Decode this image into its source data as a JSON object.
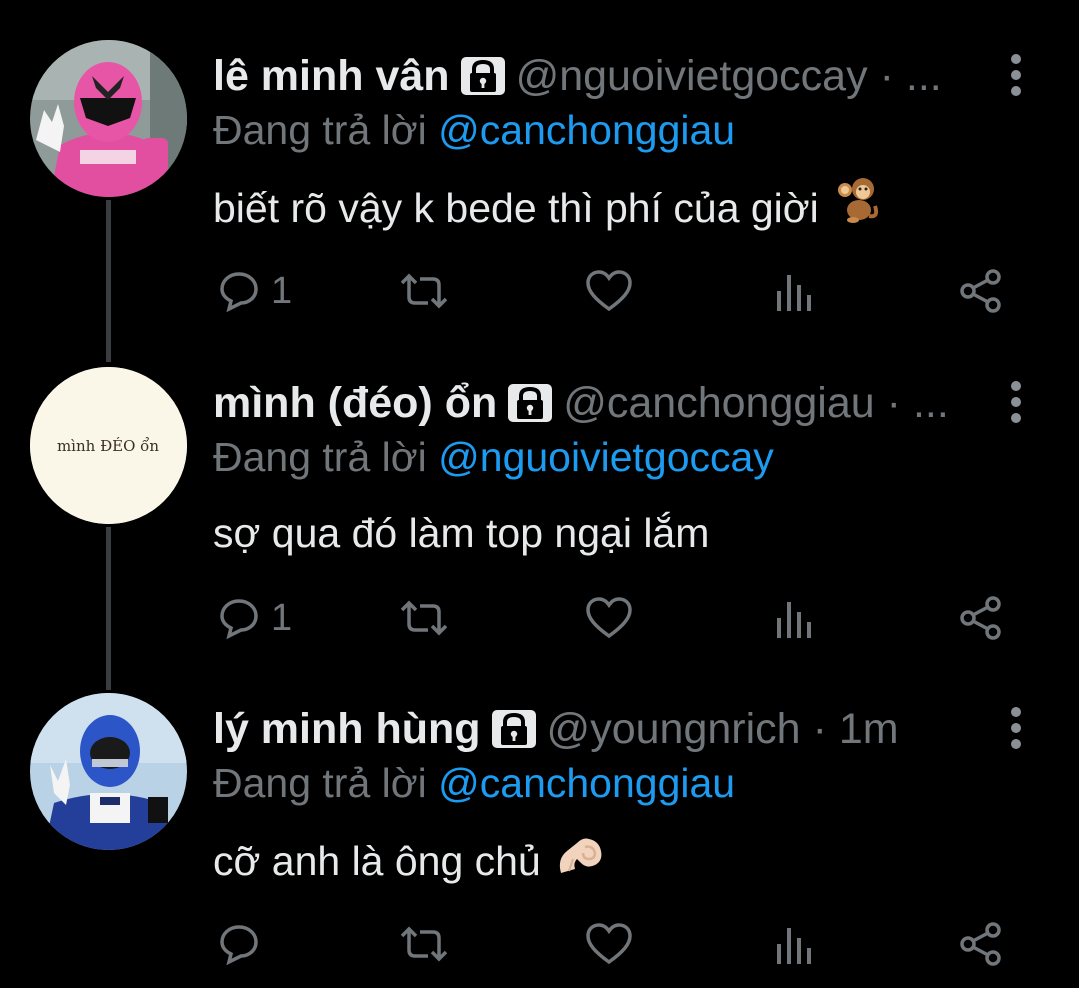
{
  "thread": [
    {
      "name": "lê minh vân",
      "handle": "@nguoivietgoccay",
      "time": "· ...",
      "replying_label": "Đang trả lời",
      "replying_to": "@canchonggiau",
      "text": "biết rõ vậy k bede thì phí của giời",
      "emoji": "🐒",
      "reply_count": "1",
      "avatar_icon": "pink-ranger-avatar"
    },
    {
      "name": "mình (đéo) ổn",
      "handle": "@canchonggiau",
      "time": "· ...",
      "replying_label": "Đang trả lời",
      "replying_to": "@nguoivietgoccay",
      "text": "sợ qua đó làm top ngại lắm",
      "emoji": "",
      "reply_count": "1",
      "avatar_text": "mình ĐÉO ổn",
      "avatar_icon": "text-avatar"
    },
    {
      "name": "lý minh hùng",
      "handle": "@youngnrich",
      "time": "· 1m",
      "replying_label": "Đang trả lời",
      "replying_to": "@canchonggiau",
      "text": "cỡ anh là ông chủ",
      "emoji": "👌🏻",
      "reply_count": "",
      "avatar_icon": "blue-ranger-avatar"
    }
  ],
  "colors": {
    "background": "#000000",
    "text": "#e7e9ea",
    "muted": "#71767b",
    "link": "#1d9bf0",
    "thread_line": "#3a3d40"
  }
}
